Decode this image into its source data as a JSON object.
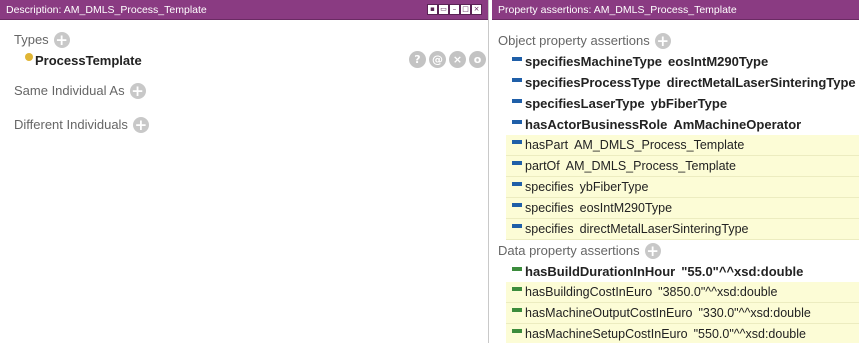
{
  "left_panel": {
    "title": "Description: AM_DMLS_Process_Template",
    "types_label": "Types",
    "type_value": "ProcessTemplate",
    "same_individual_label": "Same Individual As",
    "different_individuals_label": "Different Individuals",
    "row_actions": [
      "?",
      "@",
      "×",
      "o"
    ]
  },
  "right_panel": {
    "title": "Property assertions: AM_DMLS_Process_Template",
    "object_header": "Object property assertions",
    "object_assertions": [
      {
        "property": "specifiesMachineType",
        "value": "eosIntM290Type",
        "inferred": false
      },
      {
        "property": "specifiesProcessType",
        "value": "directMetalLaserSinteringType",
        "inferred": false
      },
      {
        "property": "specifiesLaserType",
        "value": "ybFiberType",
        "inferred": false
      },
      {
        "property": "hasActorBusinessRole",
        "value": "AmMachineOperator",
        "inferred": false
      },
      {
        "property": "hasPart",
        "value": "AM_DMLS_Process_Template",
        "inferred": true
      },
      {
        "property": "partOf",
        "value": "AM_DMLS_Process_Template",
        "inferred": true
      },
      {
        "property": "specifies",
        "value": "ybFiberType",
        "inferred": true
      },
      {
        "property": "specifies",
        "value": "eosIntM290Type",
        "inferred": true
      },
      {
        "property": "specifies",
        "value": "directMetalLaserSinteringType",
        "inferred": true
      }
    ],
    "data_header": "Data property assertions",
    "data_assertions": [
      {
        "property": "hasBuildDurationInHour",
        "value": "\"55.0\"^^xsd:double",
        "inferred": false
      },
      {
        "property": "hasBuildingCostInEuro",
        "value": "\"3850.0\"^^xsd:double",
        "inferred": true
      },
      {
        "property": "hasMachineOutputCostInEuro",
        "value": "\"330.0\"^^xsd:double",
        "inferred": true
      },
      {
        "property": "hasMachineSetupCostInEuro",
        "value": "\"550.0\"^^xsd:double",
        "inferred": true
      }
    ]
  },
  "colors": {
    "titlebar": "#8a3b82",
    "inferred_bg": "#fcfcd6",
    "object_property_icon": "#1f5fa8",
    "data_property_icon": "#3c8c3c",
    "individual_dot": "#e0b535"
  }
}
